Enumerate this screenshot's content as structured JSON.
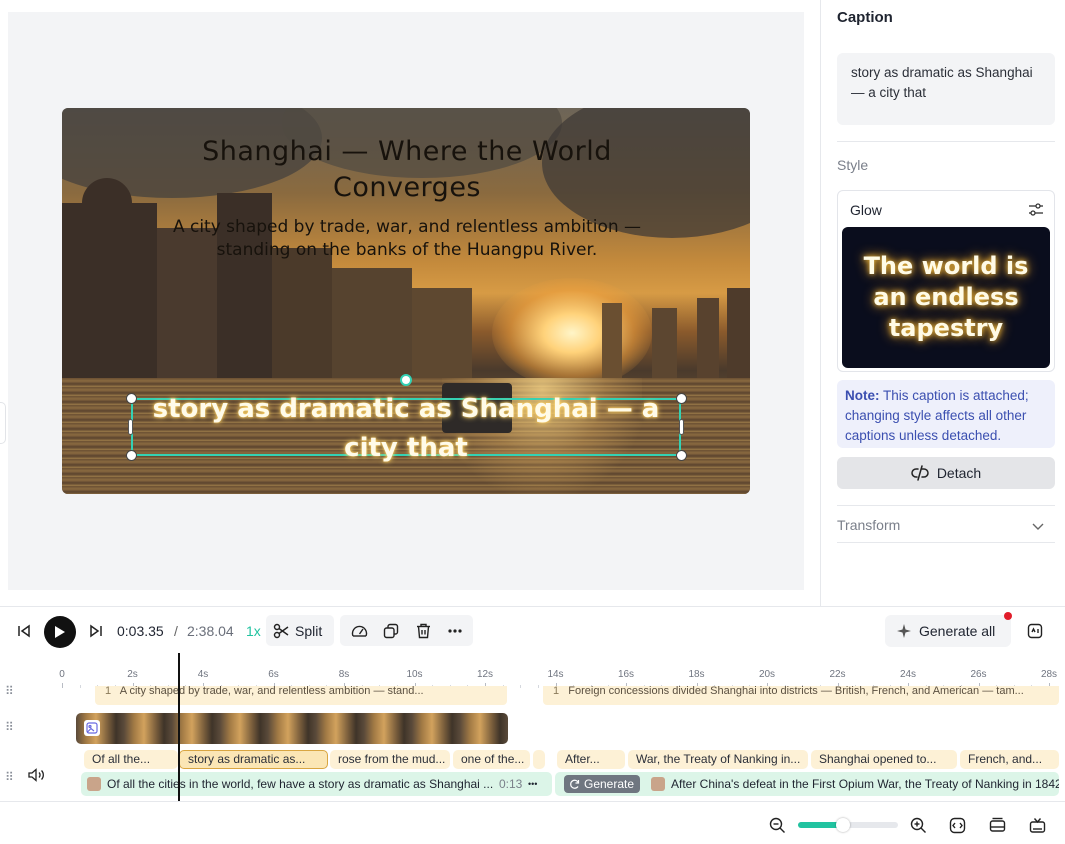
{
  "preview": {
    "title": "Shanghai — Where the World Converges",
    "subtitle": "A city shaped by trade, war, and relentless ambition — standing on the banks of the Huangpu River.",
    "caption": "story as dramatic as Shanghai — a city that"
  },
  "panel": {
    "heading": "Caption",
    "caption_text": "story as dramatic as Shanghai — a city that",
    "style_label": "Style",
    "style_name": "Glow",
    "style_preview_text": "The world is an endless tapestry",
    "note_label": "Note:",
    "note_text": "This caption is attached; changing style affects all other captions unless detached.",
    "detach_label": "Detach",
    "transform_label": "Transform"
  },
  "toolbar": {
    "current_time": "0:03.35",
    "separator": "/",
    "total_time": "2:38.04",
    "speed": "1x",
    "split_label": "Split",
    "generate_all_label": "Generate all"
  },
  "timeline": {
    "ticks": [
      "0",
      "2s",
      "4s",
      "6s",
      "8s",
      "10s",
      "12s",
      "14s",
      "16s",
      "18s",
      "20s",
      "22s",
      "24s",
      "26s",
      "28s"
    ],
    "text_tracks": [
      {
        "num": "1",
        "label": "A city shaped by trade, war, and relentless ambition — stand..."
      },
      {
        "num": "1",
        "label": "Foreign concessions divided Shanghai into districts — British, French, and American — tam..."
      }
    ],
    "captions": [
      {
        "label": "Of all the..."
      },
      {
        "label": "story as dramatic as..."
      },
      {
        "label": "rose from the mud..."
      },
      {
        "label": "one of the..."
      },
      {
        "label": ""
      },
      {
        "label": "After..."
      },
      {
        "label": "War, the Treaty of Nanking in..."
      },
      {
        "label": "Shanghai opened to..."
      },
      {
        "label": "French, and..."
      }
    ],
    "audio": [
      {
        "text": "Of all the cities in the world, few have a story as dramatic as Shanghai ...",
        "duration": "0:13",
        "more": "•••"
      },
      {
        "generate": "Generate",
        "text": "After China's defeat in the First Opium War, the Treaty of Nanking in 1842"
      }
    ]
  },
  "zoom": {
    "level": 0.45
  },
  "colors": {
    "accent": "#21c3a0",
    "selection": "#33d1b4",
    "note": "#3b4fb0",
    "alert": "#e11d2a"
  }
}
